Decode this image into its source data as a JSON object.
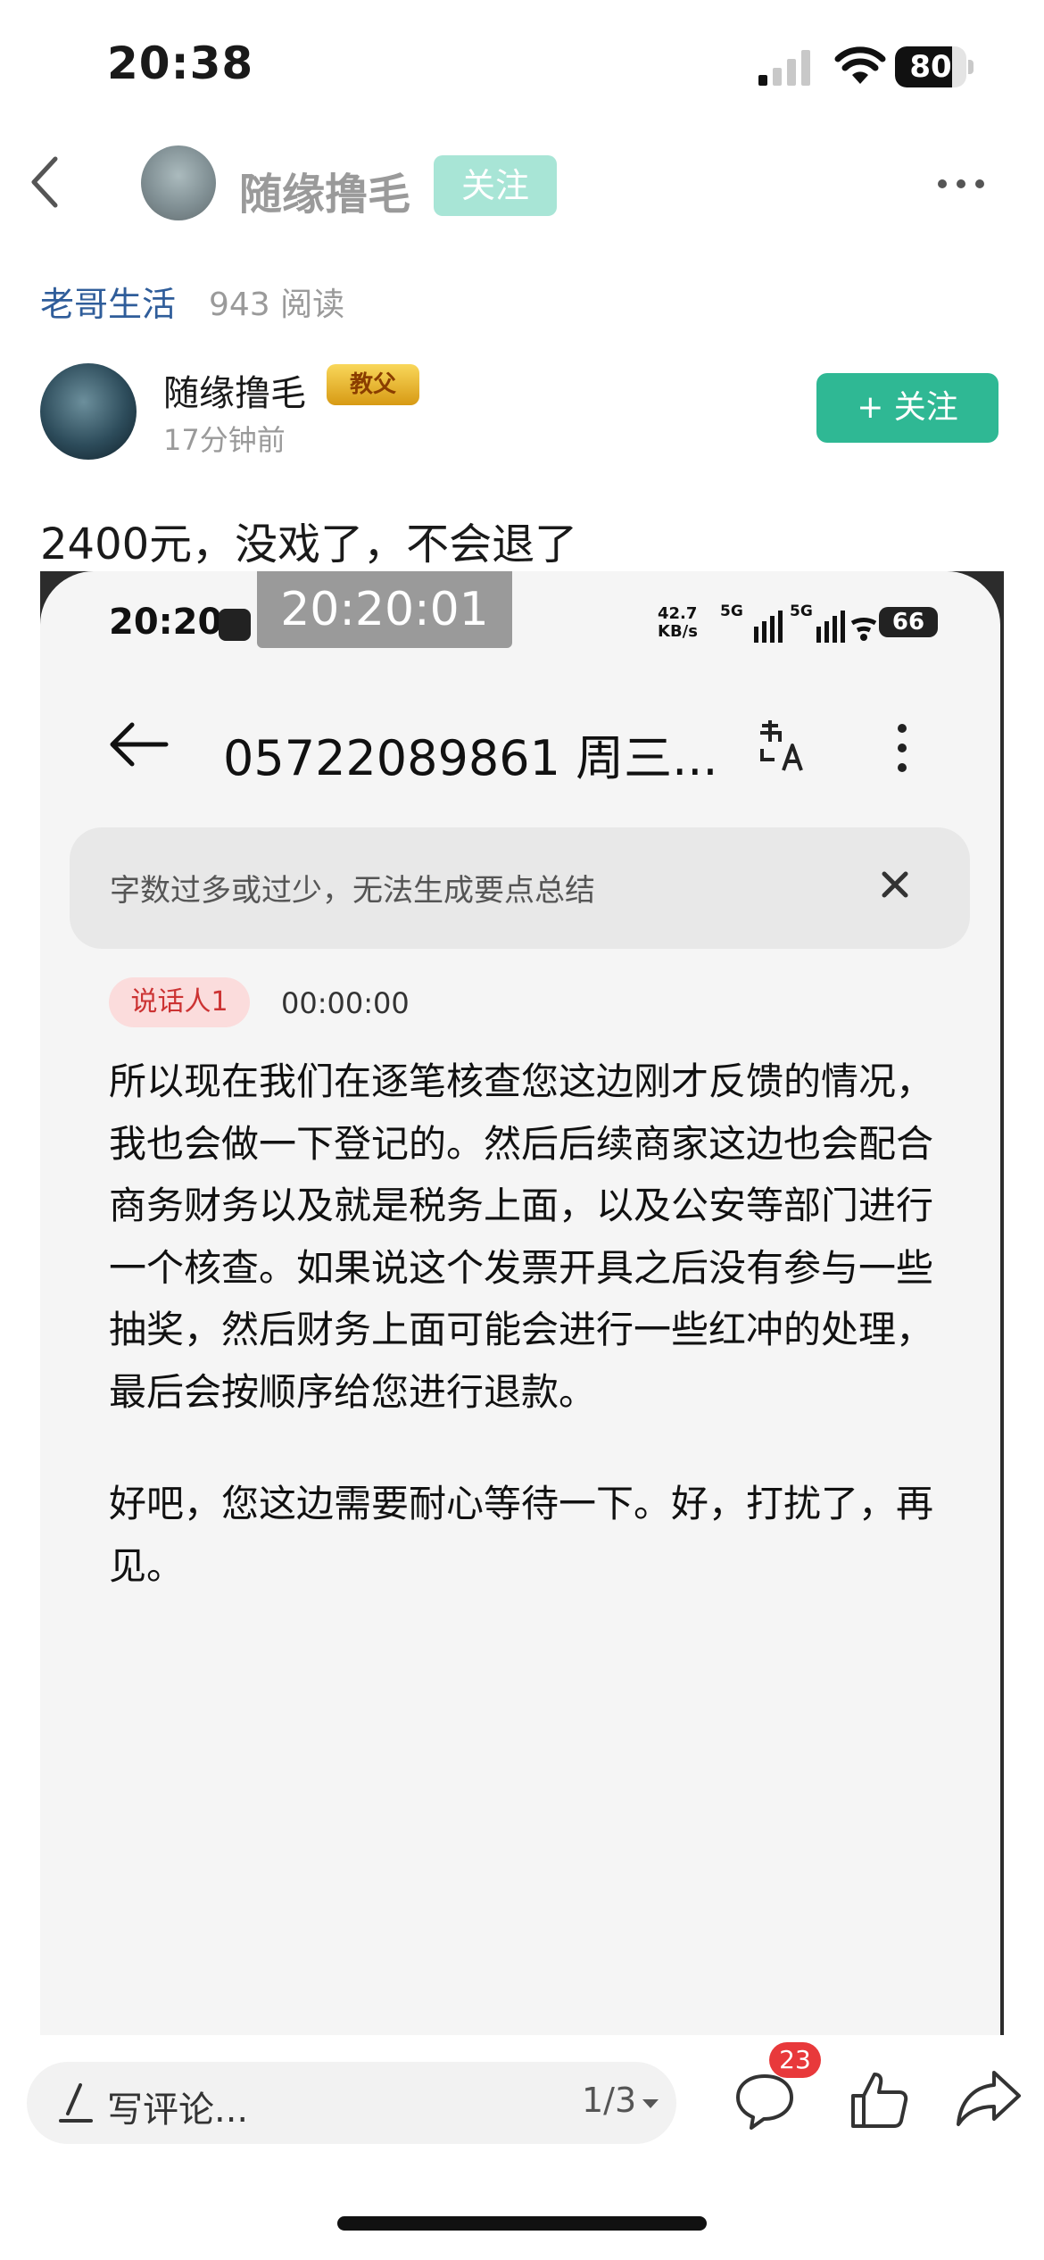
{
  "status_bar": {
    "time": "20:38",
    "battery": "80",
    "battery_level": 0.8
  },
  "nav": {
    "author_name": "随缘撸毛",
    "follow_label": "关注"
  },
  "meta": {
    "category": "老哥生活",
    "reads": "943 阅读"
  },
  "author": {
    "name": "随缘撸毛",
    "badge": "教父",
    "time_ago": "17分钟前",
    "follow_label": "+ 关注"
  },
  "post": {
    "text": "2400元，没戏了，不会退了"
  },
  "screenshot": {
    "recording_overlay": "20:20:01",
    "status_time": "20:20",
    "net_speed_value": "42.7",
    "net_speed_unit": "KB/s",
    "network_1": "5G",
    "network_2": "5G",
    "battery": "66",
    "title": "05722089861 周三...",
    "summary_notice": "字数过多或过少，无法生成要点总结",
    "speaker": "说话人1",
    "timestamp": "00:00:00",
    "paragraphs": [
      "所以现在我们在逐笔核查您这边刚才反馈的情况，我也会做一下登记的。然后后续商家这边也会配合商务财务以及就是税务上面，以及公安等部门进行一个核查。如果说这个发票开具之后没有参与一些抽奖，然后财务上面可能会进行一些红冲的处理，最后会按顺序给您进行退款。",
      "好吧，您这边需要耐心等待一下。好，打扰了，再见。"
    ]
  },
  "bottom_bar": {
    "comment_placeholder": "写评论...",
    "page_indicator": "1/3",
    "comment_count": "23"
  },
  "colors": {
    "accent_green": "#2fb894",
    "follow_disabled": "#a8e5d6",
    "link_blue": "#2f5d9a",
    "badge_red": "#e8393b"
  }
}
